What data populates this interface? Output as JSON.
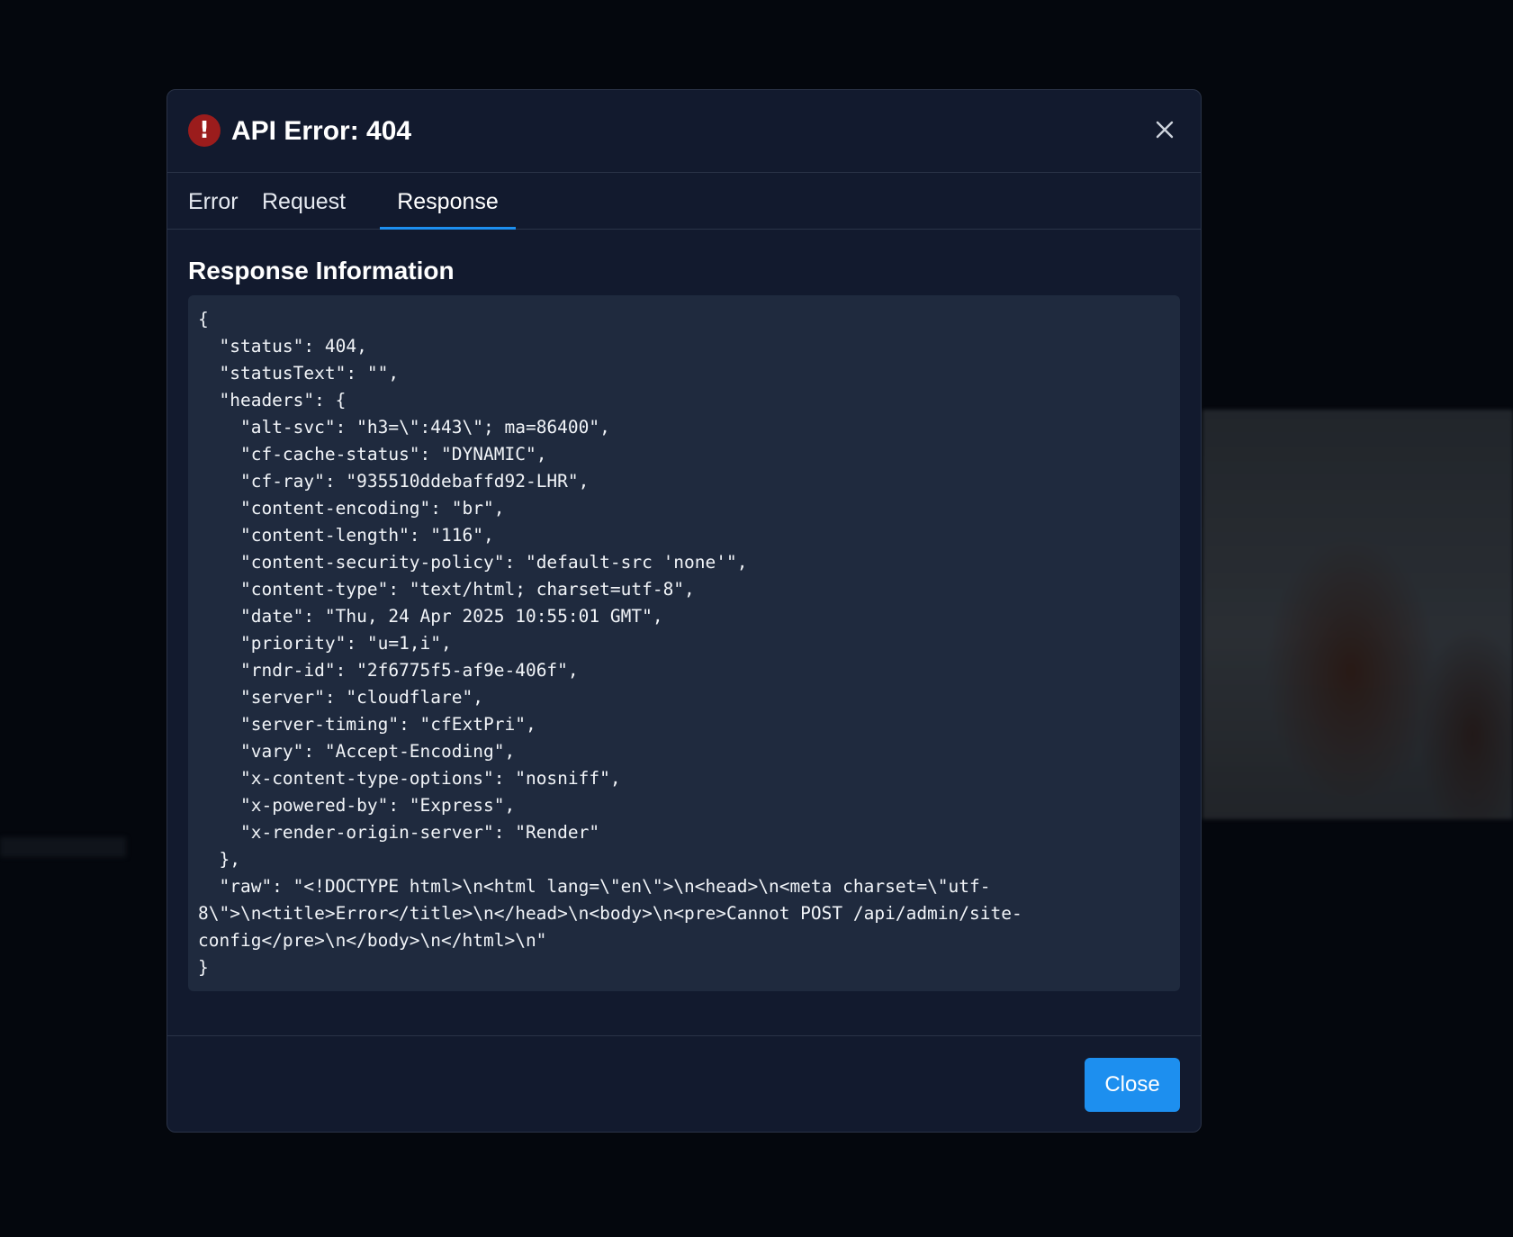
{
  "modal": {
    "title": "API Error: 404",
    "error_icon_glyph": "!",
    "close_icon": "close-icon"
  },
  "tabs": [
    {
      "label": "Error",
      "active": false
    },
    {
      "label": "Request",
      "active": false
    },
    {
      "label": "Response",
      "active": true
    }
  ],
  "content": {
    "section_title": "Response Information",
    "code": "{\n  \"status\": 404,\n  \"statusText\": \"\",\n  \"headers\": {\n    \"alt-svc\": \"h3=\\\":443\\\"; ma=86400\",\n    \"cf-cache-status\": \"DYNAMIC\",\n    \"cf-ray\": \"935510ddebaffd92-LHR\",\n    \"content-encoding\": \"br\",\n    \"content-length\": \"116\",\n    \"content-security-policy\": \"default-src 'none'\",\n    \"content-type\": \"text/html; charset=utf-8\",\n    \"date\": \"Thu, 24 Apr 2025 10:55:01 GMT\",\n    \"priority\": \"u=1,i\",\n    \"rndr-id\": \"2f6775f5-af9e-406f\",\n    \"server\": \"cloudflare\",\n    \"server-timing\": \"cfExtPri\",\n    \"vary\": \"Accept-Encoding\",\n    \"x-content-type-options\": \"nosniff\",\n    \"x-powered-by\": \"Express\",\n    \"x-render-origin-server\": \"Render\"\n  },\n  \"raw\": \"<!DOCTYPE html>\\n<html lang=\\\"en\\\">\\n<head>\\n<meta charset=\\\"utf-\n8\\\">\\n<title>Error</title>\\n</head>\\n<body>\\n<pre>Cannot POST /api/admin/site-\nconfig</pre>\\n</body>\\n</html>\\n\"\n}"
  },
  "footer": {
    "close_label": "Close"
  },
  "colors": {
    "accent": "#1d8fef",
    "error": "#9b1c1c",
    "modal_bg": "#121a2e",
    "code_bg": "#1f2a3e"
  }
}
